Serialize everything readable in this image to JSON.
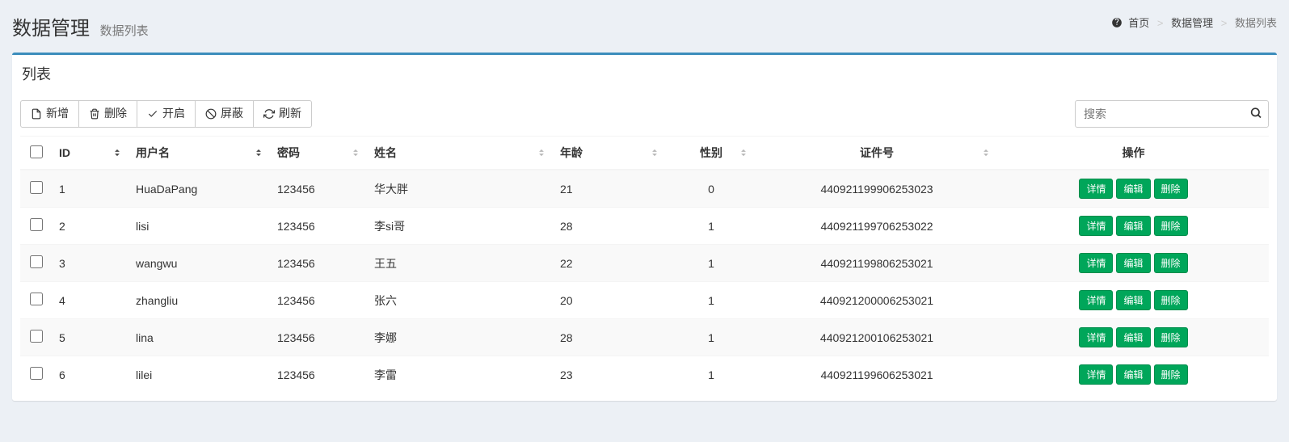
{
  "header": {
    "title": "数据管理",
    "subtitle": "数据列表"
  },
  "breadcrumb": {
    "home": "首页",
    "level1": "数据管理",
    "level2": "数据列表"
  },
  "box": {
    "title": "列表"
  },
  "toolbar": {
    "add": "新增",
    "delete": "删除",
    "enable": "开启",
    "disable": "屏蔽",
    "refresh": "刷新"
  },
  "search": {
    "placeholder": "搜索"
  },
  "columns": {
    "id": "ID",
    "username": "用户名",
    "password": "密码",
    "name": "姓名",
    "age": "年龄",
    "gender": "性别",
    "idno": "证件号",
    "actions": "操作"
  },
  "row_actions": {
    "detail": "详情",
    "edit": "编辑",
    "delete": "删除"
  },
  "rows": [
    {
      "id": "1",
      "username": "HuaDaPang",
      "password": "123456",
      "name": "华大胖",
      "age": "21",
      "gender": "0",
      "idno": "440921199906253023"
    },
    {
      "id": "2",
      "username": "lisi",
      "password": "123456",
      "name": "李si哥",
      "age": "28",
      "gender": "1",
      "idno": "440921199706253022"
    },
    {
      "id": "3",
      "username": "wangwu",
      "password": "123456",
      "name": "王五",
      "age": "22",
      "gender": "1",
      "idno": "440921199806253021"
    },
    {
      "id": "4",
      "username": "zhangliu",
      "password": "123456",
      "name": "张六",
      "age": "20",
      "gender": "1",
      "idno": "440921200006253021"
    },
    {
      "id": "5",
      "username": "lina",
      "password": "123456",
      "name": "李娜",
      "age": "28",
      "gender": "1",
      "idno": "440921200106253021"
    },
    {
      "id": "6",
      "username": "lilei",
      "password": "123456",
      "name": "李雷",
      "age": "23",
      "gender": "1",
      "idno": "440921199606253021"
    }
  ]
}
